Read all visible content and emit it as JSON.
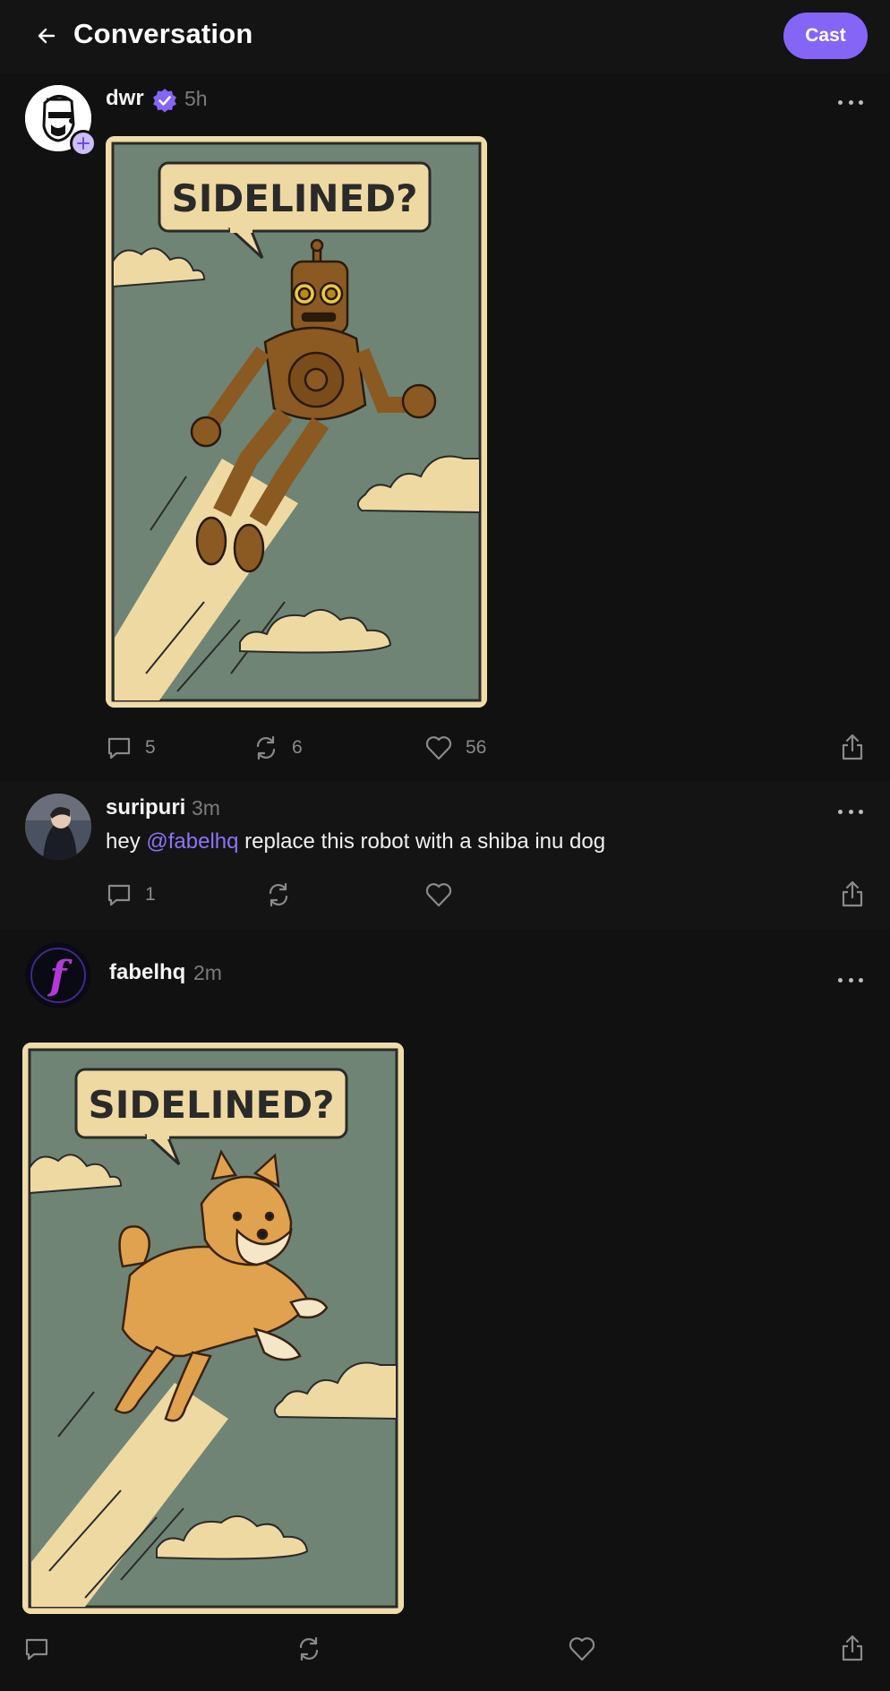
{
  "header": {
    "title": "Conversation",
    "cast_label": "Cast"
  },
  "colors": {
    "accent": "#8465f6",
    "mention": "#8d73f7",
    "background": "#111111"
  },
  "posts": [
    {
      "username": "dwr",
      "time": "5h",
      "verified": true,
      "image_caption": "SIDELINED?",
      "image_subject": "robot",
      "stats": {
        "replies": "5",
        "recasts": "6",
        "likes": "56"
      }
    },
    {
      "username": "suripuri",
      "time": "3m",
      "text_before": "hey ",
      "mention": "@fabelhq",
      "text_after": " replace this robot with a shiba inu dog",
      "stats": {
        "replies": "1"
      }
    },
    {
      "username": "fabelhq",
      "time": "2m",
      "image_caption": "SIDELINED?",
      "image_subject": "shiba inu dog"
    }
  ],
  "icons": [
    "back-arrow-icon",
    "verified-badge-icon",
    "more-icon",
    "reply-icon",
    "recast-icon",
    "like-icon",
    "share-icon",
    "follow-plus-icon"
  ]
}
